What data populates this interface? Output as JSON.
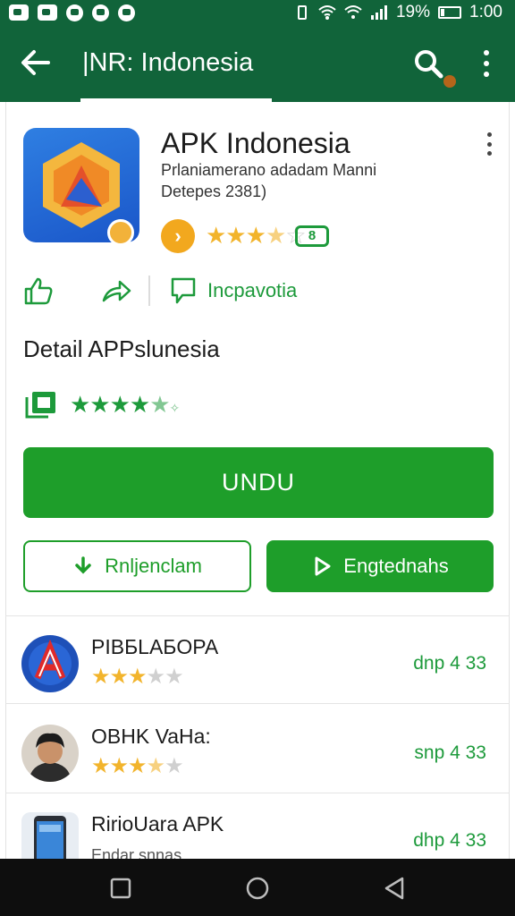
{
  "status_bar": {
    "battery": "19%",
    "time": "1:00"
  },
  "appbar": {
    "title": "|NR: Indonesia"
  },
  "app": {
    "name": "APK Indonesia",
    "developer": "Prlaniamerano adadam Manni",
    "date": "Detepes 2381)",
    "rating_badge": "8",
    "rating_stars": 3.5
  },
  "actions": {
    "review_label": "Incpavotia"
  },
  "detail": {
    "title": "Detail APPslunesia",
    "stars": 4.5
  },
  "buttons": {
    "primary": "UNDU",
    "outline": "Rnljenclam",
    "filled": "Engtednahs"
  },
  "list": [
    {
      "name": "PIBБLAБOPA",
      "sub": "",
      "stars": 3,
      "price": "dnp 4 33"
    },
    {
      "name": "OBHK  VaHa:",
      "sub": "",
      "stars": 3.5,
      "price": "snp 4 33"
    },
    {
      "name": "RirioUara APK",
      "sub": "Endar snnas",
      "stars": 0,
      "price": "dhp 4 33"
    }
  ],
  "colors": {
    "appbar": "#11643a",
    "accent_green": "#1e9e2a",
    "star_gold": "#f2b42c"
  },
  "icons": [
    "back-arrow-icon",
    "search-icon",
    "more-vert-icon",
    "thumb-up-icon",
    "share-icon",
    "review-icon",
    "download-icon",
    "play-icon"
  ]
}
